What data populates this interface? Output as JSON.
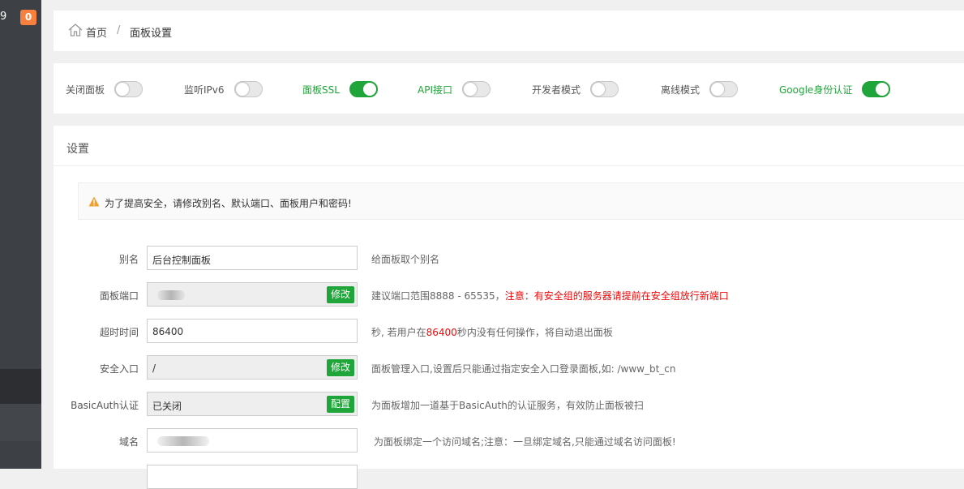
{
  "sidebar": {
    "top_number": "9",
    "notification_count": "0"
  },
  "breadcrumb": {
    "home": "首页",
    "separator": "/",
    "current": "面板设置"
  },
  "toggles": [
    {
      "label": "关闭面板",
      "on": false
    },
    {
      "label": "监听IPv6",
      "on": false
    },
    {
      "label": "面板SSL",
      "on": true
    },
    {
      "label": "API接口",
      "on": false
    },
    {
      "label": "开发者模式",
      "on": false
    },
    {
      "label": "离线模式",
      "on": false
    },
    {
      "label": "Google身份认证",
      "on": true
    }
  ],
  "settings": {
    "title": "设置",
    "warning": "为了提高安全，请修改别名、默认端口、面板用户和密码!",
    "rows": {
      "alias": {
        "label": "别名",
        "value": "后台控制面板",
        "hint": "给面板取个别名"
      },
      "port": {
        "label": "面板端口",
        "value": "",
        "button": "修改",
        "hint_prefix": "建议端口范围8888 - 65535，",
        "hint_warning": "注意：有安全组的服务器请提前在安全组放行新端口"
      },
      "timeout": {
        "label": "超时时间",
        "value": "86400",
        "hint_prefix": "秒, 若用户在",
        "hint_value": "86400",
        "hint_suffix": "秒内没有任何操作，将自动退出面板"
      },
      "entrance": {
        "label": "安全入口",
        "value": "/",
        "button": "修改",
        "hint": "面板管理入口,设置后只能通过指定安全入口登录面板,如: /www_bt_cn"
      },
      "basic_auth": {
        "label": "BasicAuth认证",
        "value": "已关闭",
        "button": "配置",
        "hint": "为面板增加一道基于BasicAuth的认证服务，有效防止面板被扫"
      },
      "domain": {
        "label": "域名",
        "value": "",
        "hint": "为面板绑定一个访问域名;注意：一旦绑定域名,只能通过域名访问面板!"
      }
    }
  },
  "colors": {
    "accent": "#20a53a",
    "warning": "#ef0808",
    "sidebar": "#3d4045",
    "badge": "#f7803f"
  }
}
